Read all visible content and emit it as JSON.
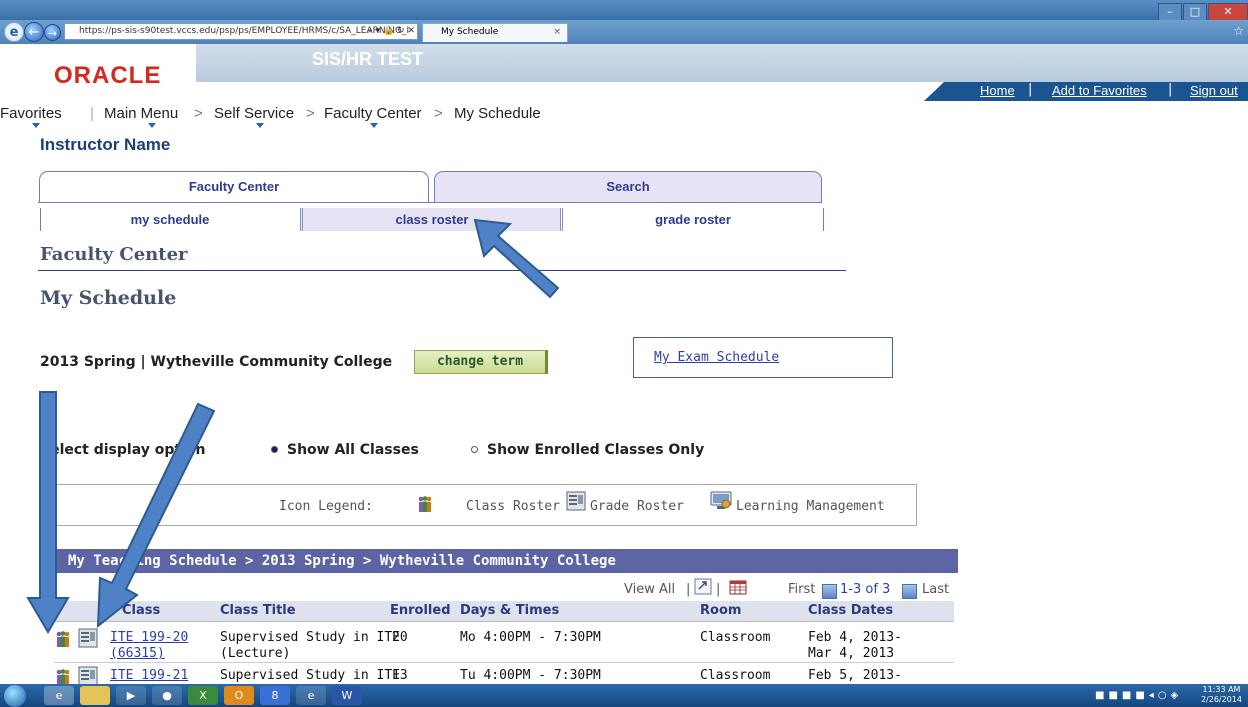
{
  "browser": {
    "url": "https://ps-sis-s90test.vccs.edu/psp/ps/EMPLOYEE/HRMS/c/SA_LEARNING_I",
    "url_controls": "⌕ ▾ 🔒 ↻ ✕",
    "tab_title": "My Schedule",
    "tab_close": "×"
  },
  "header": {
    "logo": "ORACLE",
    "environment": "SIS/HR TEST",
    "links": {
      "home": "Home",
      "favorites": "Add to Favorites",
      "signout": "Sign out"
    }
  },
  "breadcrumb": {
    "favorites": "Favorites",
    "main_menu": "Main Menu",
    "self_service": "Self Service",
    "faculty_center": "Faculty Center",
    "my_schedule": "My Schedule",
    "sep": ">"
  },
  "instructor_name": "Instructor Name",
  "tabs": {
    "faculty_center": "Faculty Center",
    "search": "Search",
    "sub": {
      "my_schedule": "my schedule",
      "class_roster": "class roster",
      "grade_roster": "grade roster"
    }
  },
  "page": {
    "heading": "Faculty Center",
    "subheading": "My Schedule",
    "term": "2013 Spring | Wytheville Community College",
    "change_term": "change term",
    "exam_schedule": "My Exam Schedule",
    "display_option_label": "Select display option",
    "radio_all": "Show All Classes",
    "radio_enrolled": "Show Enrolled Classes Only"
  },
  "legend": {
    "label": "Icon Legend:",
    "class_roster": "Class Roster",
    "grade_roster": "Grade Roster",
    "learning_mgmt": "Learning Management"
  },
  "grid": {
    "title": "My Teaching Schedule > 2013 Spring > Wytheville Community College",
    "view_all": "View All",
    "pipe": "|",
    "first": "First",
    "range": "1-3 of 3",
    "last": "Last",
    "columns": {
      "classes": "Class",
      "title": "Class Title",
      "enrolled": "Enrolled",
      "days": "Days & Times",
      "room": "Room",
      "dates": "Class Dates"
    },
    "rows": [
      {
        "class_line1": "ITE 199-20",
        "class_line2": "(66315)",
        "title_line1": "Supervised Study in ITE",
        "title_line2": "(Lecture)",
        "enrolled": "20",
        "days": "Mo 4:00PM - 7:30PM",
        "room": "Classroom",
        "dates_line1": "Feb 4, 2013-",
        "dates_line2": "Mar 4, 2013"
      },
      {
        "class_line1": "ITE 199-21",
        "class_line2": "",
        "title_line1": "Supervised Study in ITE",
        "title_line2": "",
        "enrolled": "13",
        "days": "Tu 4:00PM - 7:30PM",
        "room": "Classroom",
        "dates_line1": "Feb 5, 2013-",
        "dates_line2": ""
      }
    ]
  },
  "taskbar": {
    "clock_time": "11:33 AM",
    "clock_date": "2/26/2014",
    "word": "W"
  },
  "colors": {
    "arrow": "#4f81c7",
    "arrow_stroke": "#2d5a92",
    "oracle_red": "#d12b1f",
    "grid_header": "#5c64a4"
  },
  "icons": [
    "class-roster-icon",
    "grade-roster-icon",
    "learning-management-icon",
    "refresh-icon",
    "close-icon"
  ]
}
